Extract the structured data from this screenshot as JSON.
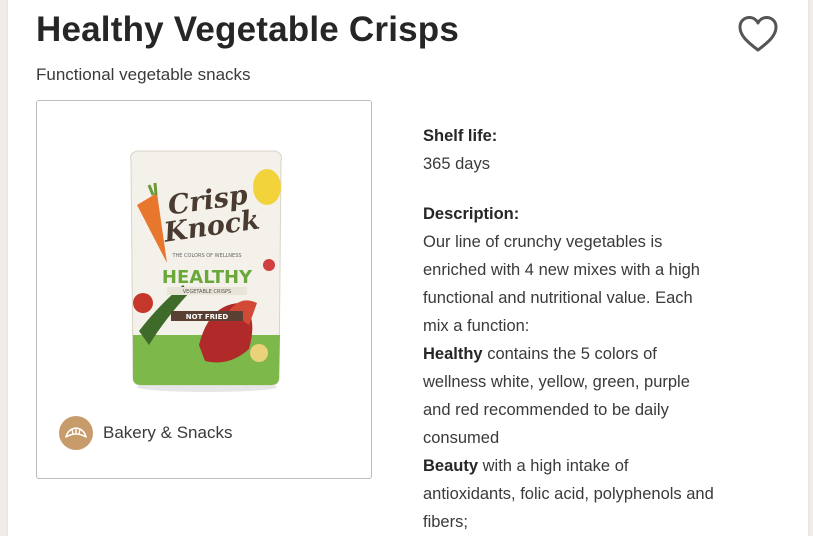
{
  "product": {
    "title": "Healthy Vegetable Crisps",
    "subtitle": "Functional vegetable snacks",
    "category_label": "Bakery & Snacks",
    "image_icon": "product-package-image",
    "category_icon": "croissant-icon",
    "favorite_icon": "heart-outline-icon"
  },
  "package": {
    "brand_line1": "Crisp",
    "brand_line2": "Knock",
    "tagline": "THE COLORS OF WELLNESS",
    "name": "HEALTHY",
    "name_sub": "VEGETABLE CRISPS",
    "badge": "NOT FRIED"
  },
  "details": {
    "shelf_life_label": "Shelf life:",
    "shelf_life_value": "365 days",
    "description_label": "Description:",
    "description_lines": [
      "Our line of crunchy vegetables is",
      "enriched with 4 new mixes with a high",
      "functional and nutritional value. Each",
      "mix a function:"
    ],
    "healthy_bold": "Healthy",
    "healthy_lines": [
      " contains the 5 colors of",
      "wellness white, yellow, green, purple",
      "and red recommended to be daily",
      "consumed"
    ],
    "beauty_bold": "Beauty",
    "beauty_lines": [
      " with a high intake of",
      "antioxidants, folic acid, polyphenols and",
      "fibers;"
    ]
  },
  "colors": {
    "category_badge": "#c89b6b",
    "heart_stroke": "#555555",
    "card_border": "#bdbdbd"
  }
}
